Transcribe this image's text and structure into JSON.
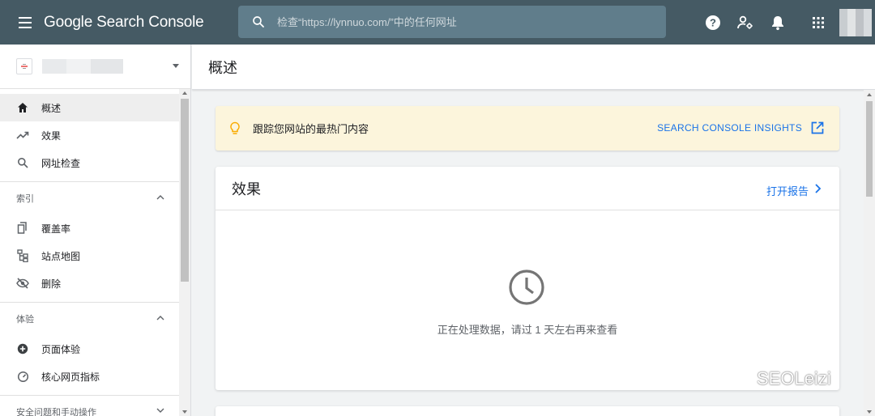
{
  "app": {
    "logo_text": "Google Search Console"
  },
  "search": {
    "placeholder": "检查“https://lynnuo.com/”中的任何网址"
  },
  "top_icons": [
    "help-icon",
    "manage-users-icon",
    "notifications-icon",
    "apps-grid-icon",
    "account-avatar"
  ],
  "sidebar": {
    "nav": [
      {
        "label": "概述",
        "icon": "home-icon",
        "active": true
      },
      {
        "label": "效果",
        "icon": "trending-up-icon"
      },
      {
        "label": "网址检查",
        "icon": "search-icon"
      }
    ],
    "sections": [
      {
        "title": "索引",
        "items": [
          {
            "label": "覆盖率",
            "icon": "copy-icon"
          },
          {
            "label": "站点地图",
            "icon": "sitemap-icon"
          },
          {
            "label": "删除",
            "icon": "visibility-off-icon"
          }
        ]
      },
      {
        "title": "体验",
        "items": [
          {
            "label": "页面体验",
            "icon": "add-circle-icon"
          },
          {
            "label": "核心网页指标",
            "icon": "speed-icon"
          }
        ]
      },
      {
        "title": "安全问题和手动操作",
        "items": []
      }
    ]
  },
  "main": {
    "title": "概述",
    "insights_banner": {
      "text": "跟踪您网站的最热门内容",
      "link": "SEARCH CONSOLE INSIGHTS"
    },
    "performance_card": {
      "title": "效果",
      "open_report": "打开报告",
      "processing_text": "正在处理数据，请过 1 天左右再来查看"
    }
  },
  "watermark": {
    "text": "SEOLeizi"
  },
  "colors": {
    "topbar": "#455a64",
    "search_bg": "#607d8b",
    "link": "#1a73e8",
    "banner_bg": "#fcf5dc"
  }
}
